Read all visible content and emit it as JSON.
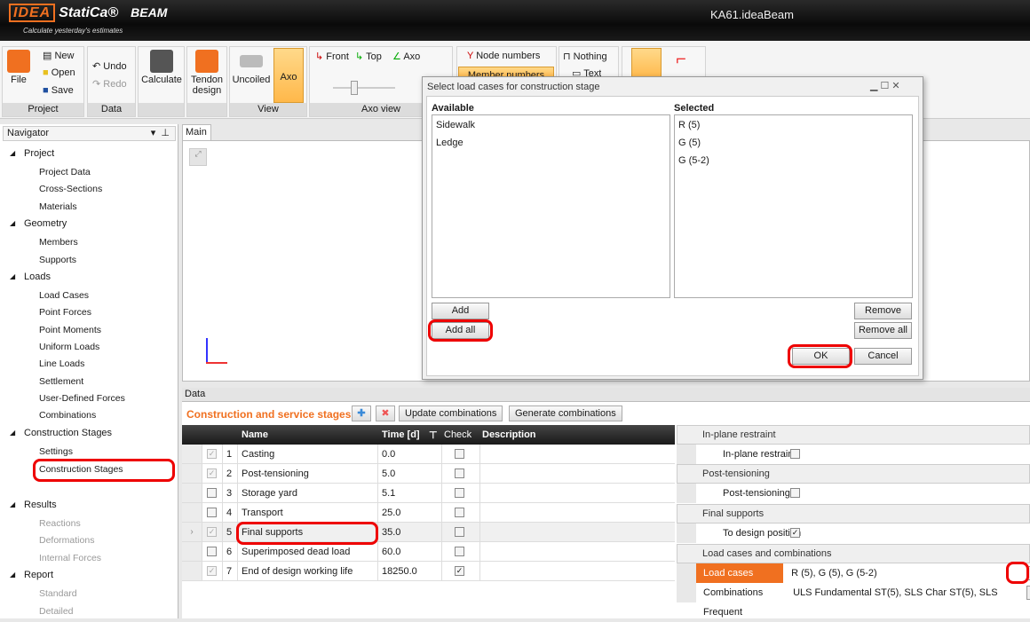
{
  "app": {
    "brand": "IDEA",
    "product": "StatiCa®",
    "module": "BEAM",
    "tagline": "Calculate yesterday's estimates",
    "window_title": "KA61.ideaBeam"
  },
  "ribbon": {
    "file": "File",
    "new": "New",
    "open": "Open",
    "save": "Save",
    "undo": "Undo",
    "redo": "Redo",
    "calculate": "Calculate",
    "tendon": "Tendon design",
    "uncoiled": "Uncoiled",
    "axo": "Axo",
    "front": "Front",
    "top": "Top",
    "axo_view": "Axo",
    "node_numbers": "Node numbers",
    "member_numbers": "Member numbers",
    "nothing": "Nothing",
    "text": "Text",
    "groups": {
      "project": "Project",
      "data": "Data",
      "view": "View",
      "axo_view": "Axo view"
    }
  },
  "navigator": {
    "title": "Navigator",
    "items": [
      {
        "label": "Project",
        "level": 0
      },
      {
        "label": "Project Data",
        "level": 1
      },
      {
        "label": "Cross-Sections",
        "level": 1
      },
      {
        "label": "Materials",
        "level": 1
      },
      {
        "label": "Geometry",
        "level": 0
      },
      {
        "label": "Members",
        "level": 1
      },
      {
        "label": "Supports",
        "level": 1
      },
      {
        "label": "Loads",
        "level": 0
      },
      {
        "label": "Load Cases",
        "level": 1
      },
      {
        "label": "Point Forces",
        "level": 1
      },
      {
        "label": "Point Moments",
        "level": 1
      },
      {
        "label": "Uniform Loads",
        "level": 1
      },
      {
        "label": "Line Loads",
        "level": 1
      },
      {
        "label": "Settlement",
        "level": 1
      },
      {
        "label": "User-Defined Forces",
        "level": 1
      },
      {
        "label": "Combinations",
        "level": 1
      },
      {
        "label": "Construction Stages",
        "level": 0
      },
      {
        "label": "Settings",
        "level": 1
      },
      {
        "label": "Construction Stages",
        "level": 1,
        "highlighted": true
      },
      {
        "label": "Results",
        "level": 0
      },
      {
        "label": "Reactions",
        "level": 1,
        "disabled": true
      },
      {
        "label": "Deformations",
        "level": 1,
        "disabled": true
      },
      {
        "label": "Internal Forces",
        "level": 1,
        "disabled": true
      },
      {
        "label": "Report",
        "level": 0
      },
      {
        "label": "Standard",
        "level": 1,
        "disabled": true
      },
      {
        "label": "Detailed",
        "level": 1,
        "disabled": true
      }
    ]
  },
  "main_tab": "Main",
  "data_panel": {
    "title": "Data",
    "section_title": "Construction and service stages",
    "update_btn": "Update combinations",
    "generate_btn": "Generate combinations",
    "columns": {
      "name": "Name",
      "time": "Time [d]",
      "check": "Check",
      "description": "Description"
    },
    "rows": [
      {
        "n": "1",
        "name": "Casting",
        "time": "0.0",
        "active": true,
        "check": false
      },
      {
        "n": "2",
        "name": "Post-tensioning",
        "time": "5.0",
        "active": true,
        "check": false
      },
      {
        "n": "3",
        "name": "Storage yard",
        "time": "5.1",
        "active": false,
        "check": false
      },
      {
        "n": "4",
        "name": "Transport",
        "time": "25.0",
        "active": false,
        "check": false
      },
      {
        "n": "5",
        "name": "Final supports",
        "time": "35.0",
        "active": true,
        "check": false,
        "current": true
      },
      {
        "n": "6",
        "name": "Superimposed dead load",
        "time": "60.0",
        "active": false,
        "check": false
      },
      {
        "n": "7",
        "name": "End of design working life",
        "time": "18250.0",
        "active": true,
        "check": true
      }
    ]
  },
  "properties": {
    "in_plane_group": "In-plane restraint",
    "in_plane": "In-plane restraint",
    "pt_group": "Post-tensioning",
    "pt": "Post-tensioning",
    "fs_group": "Final supports",
    "fs": "To design position",
    "lc_group": "Load cases and combinations",
    "load_cases_label": "Load cases",
    "load_cases_value": "R (5), G (5), G (5-2)",
    "combinations_label": "Combinations",
    "combinations_value": "ULS Fundamental ST(5), SLS Char ST(5), SLS Frequent"
  },
  "dialog": {
    "title": "Select load cases for construction stage",
    "available_label": "Available",
    "selected_label": "Selected",
    "available": [
      "Sidewalk",
      "Ledge"
    ],
    "selected": [
      "R (5)",
      "G (5)",
      "G (5-2)"
    ],
    "add": "Add",
    "add_all": "Add all",
    "remove": "Remove",
    "remove_all": "Remove all",
    "ok": "OK",
    "cancel": "Cancel"
  },
  "colors": {
    "accent": "#f07020",
    "highlight": "#e00000"
  }
}
